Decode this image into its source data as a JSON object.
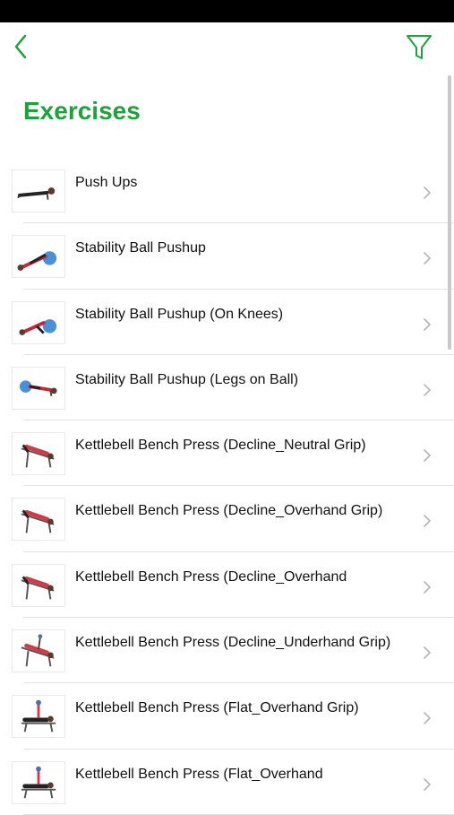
{
  "header": {
    "title": "Exercises",
    "back_icon": "chevron-left-icon",
    "filter_icon": "filter-icon",
    "accent_color": "#1ea23a"
  },
  "exercises": [
    {
      "label": "Push Ups",
      "thumb": "pushup"
    },
    {
      "label": "Stability Ball Pushup",
      "thumb": "ball-pushup"
    },
    {
      "label": "Stability Ball Pushup (On Knees)",
      "thumb": "ball-knees"
    },
    {
      "label": "Stability Ball Pushup (Legs on Ball)",
      "thumb": "ball-legs"
    },
    {
      "label": "Kettlebell Bench Press (Decline_Neutral Grip)",
      "thumb": "decline"
    },
    {
      "label": "Kettlebell Bench Press (Decline_Overhand Grip)",
      "thumb": "decline"
    },
    {
      "label": "Kettlebell Bench Press (Decline_Overhand",
      "thumb": "decline"
    },
    {
      "label": "Kettlebell Bench Press (Decline_Underhand Grip)",
      "thumb": "decline-up"
    },
    {
      "label": "Kettlebell Bench Press (Flat_Overhand Grip)",
      "thumb": "flat"
    },
    {
      "label": "Kettlebell Bench Press (Flat_Overhand",
      "thumb": "flat"
    }
  ]
}
